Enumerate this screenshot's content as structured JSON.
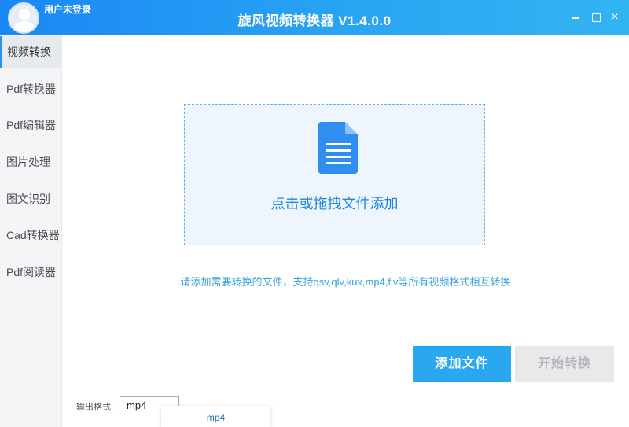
{
  "user": {
    "name": "用户未登录"
  },
  "app": {
    "title": "旋风视频转换器 V1.4.0.0"
  },
  "window": {
    "close_glyph": "×"
  },
  "sidebar": {
    "items": [
      {
        "label": "视频转换",
        "active": true
      },
      {
        "label": "Pdf转换器"
      },
      {
        "label": "Pdf编辑器"
      },
      {
        "label": "图片处理"
      },
      {
        "label": "图文识别"
      },
      {
        "label": "Cad转换器"
      },
      {
        "label": "Pdf阅读器"
      }
    ]
  },
  "dropzone": {
    "text": "点击或拖拽文件添加",
    "icon": "document-icon"
  },
  "hint": "请添加需要转换的文件，支持qsv,qlv,kux,mp4,flv等所有视频格式相互转换",
  "actions": {
    "add_label": "添加文件",
    "start_label": "开始转换"
  },
  "output": {
    "label": "输出格式:",
    "selected": "mp4",
    "options": [
      "mp4"
    ]
  },
  "colors": {
    "accent": "#29a8ef",
    "titlebar_start": "#1a87f5",
    "titlebar_end": "#33b4f2"
  }
}
